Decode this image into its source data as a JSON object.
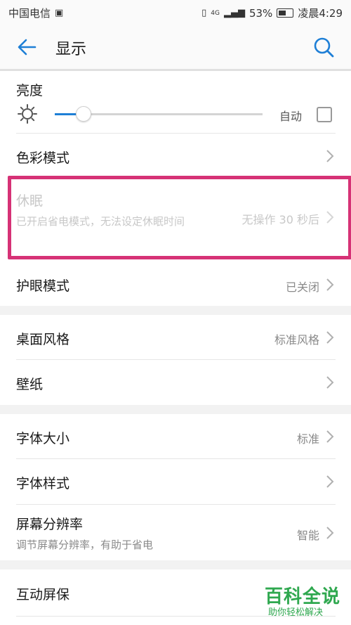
{
  "status_bar": {
    "carrier": "中国电信",
    "network": "4G",
    "battery": "53%",
    "time": "凌晨4:29"
  },
  "header": {
    "title": "显示",
    "back_icon": "arrow-left-icon",
    "search_icon": "search-icon"
  },
  "brightness": {
    "label": "亮度",
    "auto_label": "自动",
    "level": 0.14,
    "auto_checked": false
  },
  "rows": {
    "color_mode": {
      "label": "色彩模式"
    },
    "sleep": {
      "label": "休眠",
      "sub": "已开启省电模式，无法设定休眠时间",
      "value": "无操作 30 秒后",
      "disabled": true
    },
    "eye_comfort": {
      "label": "护眼模式",
      "value": "已关闭"
    },
    "home_style": {
      "label": "桌面风格",
      "value": "标准风格"
    },
    "wallpaper": {
      "label": "壁纸"
    },
    "font_size": {
      "label": "字体大小",
      "value": "标准"
    },
    "font_style": {
      "label": "字体样式"
    },
    "resolution": {
      "label": "屏幕分辨率",
      "sub": "调节屏幕分辨率，有助于省电",
      "value": "智能"
    },
    "screensaver": {
      "label": "互动屏保"
    }
  },
  "colors": {
    "accent": "#1e7fd6",
    "highlight": "#d63276",
    "watermark": "#2fa84f"
  },
  "watermark": {
    "title": "百科全说",
    "sub": "助你轻松解决"
  }
}
